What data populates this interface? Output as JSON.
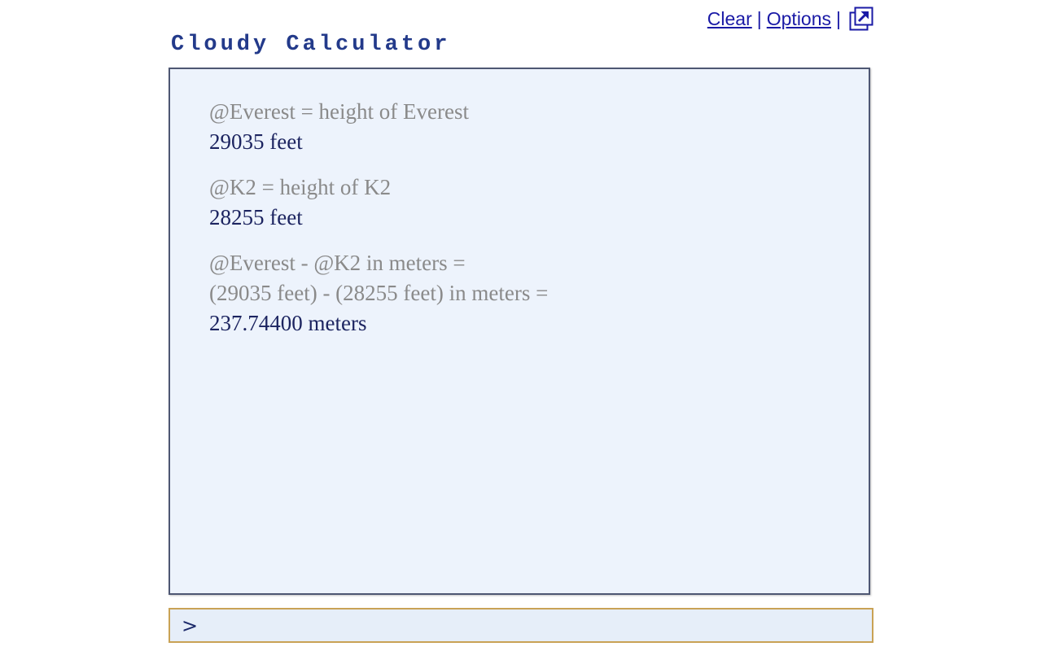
{
  "header": {
    "clear_label": "Clear",
    "options_label": "Options",
    "separator": "|",
    "popout_icon": "popout-arrow-icon"
  },
  "app": {
    "title": "Cloudy Calculator"
  },
  "output": {
    "entries": [
      {
        "lines": [
          "@Everest = height of Everest"
        ],
        "result": "29035 feet"
      },
      {
        "lines": [
          "@K2 = height of K2"
        ],
        "result": "28255 feet"
      },
      {
        "lines": [
          "@Everest - @K2 in meters =",
          "(29035 feet) - (28255 feet) in meters ="
        ],
        "result": "237.74400 meters"
      }
    ]
  },
  "input": {
    "prompt": ">",
    "value": "",
    "placeholder": ""
  },
  "colors": {
    "link": "#1a1aa6",
    "title": "#233a8a",
    "panel_bg": "#edf3fc",
    "panel_border": "#4e5773",
    "input_border": "#c9a255",
    "expression_text": "#8a8a8a",
    "result_text": "#1c2460"
  }
}
